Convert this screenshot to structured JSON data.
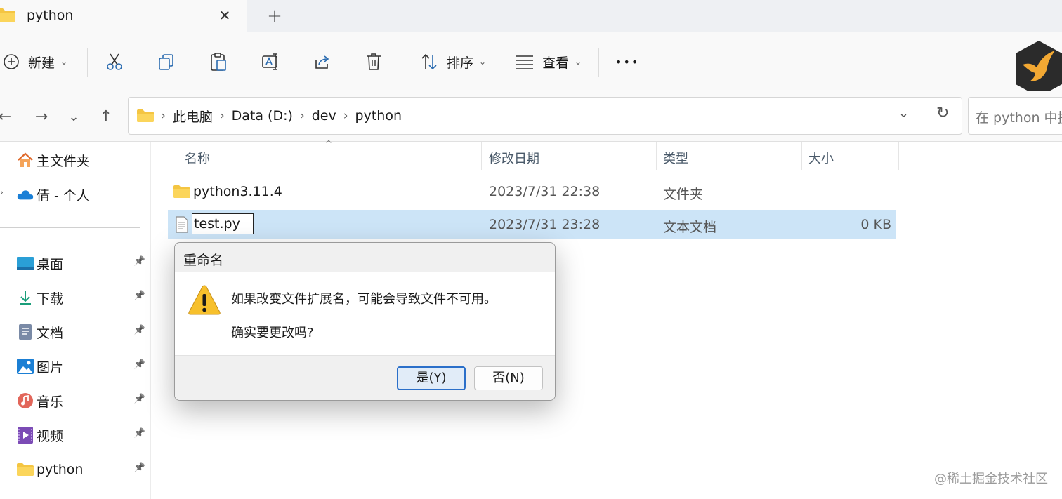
{
  "tab": {
    "title": "python",
    "close": "✕",
    "new": "+"
  },
  "toolbar": {
    "new_label": "新建",
    "sort_label": "排序",
    "view_label": "查看",
    "more": "•••",
    "caret": "⌄"
  },
  "nav": {
    "back": "←",
    "forward": "→",
    "recent": "⌄",
    "up": "↑",
    "breadcrumb": [
      "此电脑",
      "Data (D:)",
      "dev",
      "python"
    ],
    "crumb_sep": "›",
    "dropdown": "⌄",
    "refresh": "↻",
    "search_placeholder": "在 python 中搜"
  },
  "sidebar": {
    "items": [
      {
        "label": "主文件夹",
        "icon": "home-icon"
      },
      {
        "label": "倩 - 个人",
        "icon": "onedrive-icon"
      },
      {
        "label": "桌面",
        "icon": "desktop-icon",
        "pinned": true
      },
      {
        "label": "下载",
        "icon": "download-icon",
        "pinned": true
      },
      {
        "label": "文档",
        "icon": "document-icon",
        "pinned": true
      },
      {
        "label": "图片",
        "icon": "pictures-icon",
        "pinned": true
      },
      {
        "label": "音乐",
        "icon": "music-icon",
        "pinned": true
      },
      {
        "label": "视频",
        "icon": "video-icon",
        "pinned": true
      },
      {
        "label": "python",
        "icon": "folder-icon",
        "pinned": true
      }
    ],
    "pin": "📌"
  },
  "filelist": {
    "columns": {
      "name": "名称",
      "modified": "修改日期",
      "type": "类型",
      "size": "大小"
    },
    "sort_indicator": "^",
    "rows": [
      {
        "name": "python3.11.4",
        "modified": "2023/7/31 22:38",
        "type": "文件夹",
        "size": ""
      },
      {
        "name": "test.py",
        "modified": "2023/7/31 23:28",
        "type": "文本文档",
        "size": "0 KB"
      }
    ]
  },
  "dialog": {
    "title": "重命名",
    "message_line1": "如果改变文件扩展名，可能会导致文件不可用。",
    "message_line2": "确实要更改吗?",
    "yes_label": "是(Y)",
    "no_label": "否(N)"
  },
  "watermark": "@稀土掘金技术社区",
  "colors": {
    "selected_row": "#cce4f7",
    "accent": "#2b6fc9",
    "folder": "#f4c542"
  }
}
